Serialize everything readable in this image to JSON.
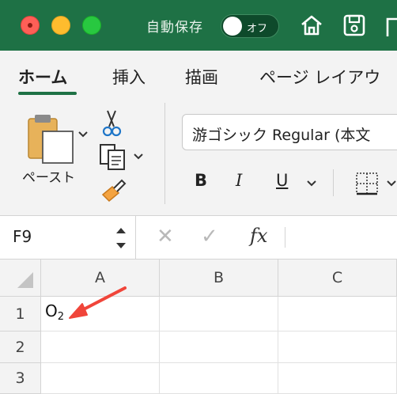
{
  "window": {
    "autosave_label": "自動保存",
    "autosave_toggle": "オフ",
    "icons": [
      "home-icon",
      "save-icon",
      "undo-icon"
    ]
  },
  "ribbon_tabs": [
    {
      "label": "ホーム",
      "active": true
    },
    {
      "label": "挿入",
      "active": false
    },
    {
      "label": "描画",
      "active": false
    },
    {
      "label": "ページ レイアウ",
      "active": false
    }
  ],
  "clipboard": {
    "paste_label": "ペースト"
  },
  "font": {
    "family_value": "游ゴシック Regular (本文",
    "bold": "B",
    "italic": "I",
    "underline": "U"
  },
  "formula_bar": {
    "name_box": "F9",
    "fx": "fx"
  },
  "sheet": {
    "columns": [
      "A",
      "B",
      "C"
    ],
    "rows": [
      "1",
      "2",
      "3"
    ],
    "cells": {
      "A1": {
        "main": "O",
        "sub": "2"
      }
    },
    "annotation_color": "#f0453a"
  },
  "colors": {
    "title_bar": "#1e7145",
    "accent": "#1e7145"
  }
}
